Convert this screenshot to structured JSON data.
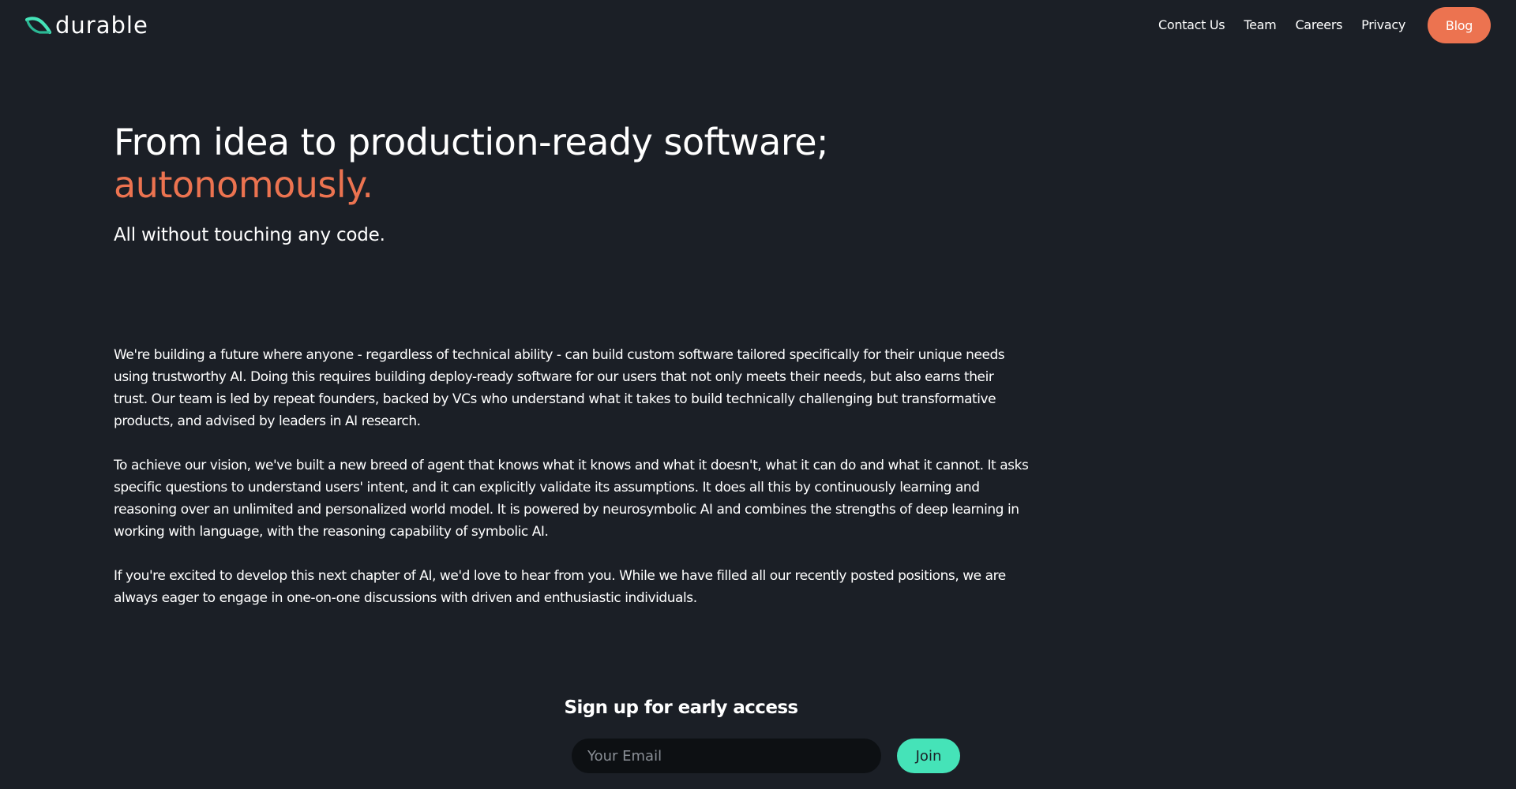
{
  "header": {
    "logo_text": "durable",
    "nav": [
      {
        "label": "Contact Us"
      },
      {
        "label": "Team"
      },
      {
        "label": "Careers"
      },
      {
        "label": "Privacy"
      }
    ],
    "blog_label": "Blog"
  },
  "hero": {
    "headline": "From idea to production-ready software;",
    "headline_accent": "autonomously.",
    "subheadline": "All without touching any code."
  },
  "about": {
    "paragraphs": [
      "We're building a future where anyone - regardless of technical ability - can build custom software tailored specifically for their unique needs using trustworthy AI. Doing this requires building deploy-ready software for our users that not only meets their needs, but also earns their trust. Our team is led by repeat founders, backed by VCs who understand what it takes to build technically challenging but transformative products, and advised by leaders in AI research.",
      "To achieve our vision, we've built a new breed of agent that knows what it knows and what it doesn't, what it can do and what it cannot. It asks specific questions to understand users' intent, and it can explicitly validate its assumptions. It does all this by continuously learning and reasoning over an unlimited and personalized world model. It is powered by neurosymbolic AI and combines the strengths of deep learning in working with language, with the reasoning capability of symbolic AI.",
      "If you're excited to develop this next chapter of AI, we'd love to hear from you. While we have filled all our recently posted positions, we are always eager to engage in one-on-one discussions with driven and enthusiastic individuals."
    ]
  },
  "signup": {
    "title": "Sign up for early access",
    "email_placeholder": "Your Email",
    "email_value": "",
    "join_label": "Join"
  },
  "colors": {
    "background": "#1b1f26",
    "accent_orange": "#ec7350",
    "accent_teal": "#45e3b8",
    "input_bg": "#0d1013"
  },
  "icons": {
    "logo": "durable-logo-icon"
  }
}
